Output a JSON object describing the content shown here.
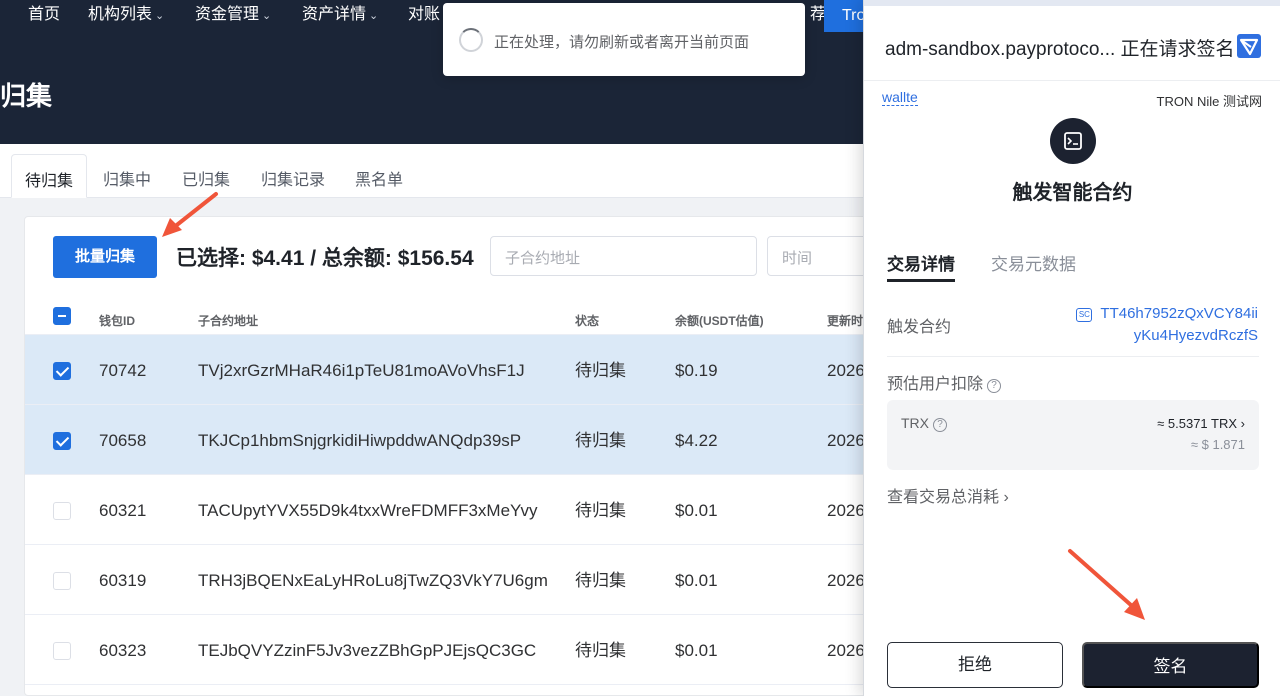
{
  "nav": {
    "items": [
      "首页",
      "机构列表",
      "资金管理",
      "资产详情",
      "对账"
    ],
    "right_button": "Tro",
    "right_fragment": "荐"
  },
  "page": {
    "title": "归集"
  },
  "tabs": [
    "待归集",
    "归集中",
    "已归集",
    "归集记录",
    "黑名单"
  ],
  "toolbar": {
    "batch_button": "批量归集",
    "summary": "已选择: $4.41 / 总余额: $156.54",
    "contract_placeholder": "子合约地址",
    "time_placeholder": "时间"
  },
  "table": {
    "headers": [
      "钱包ID",
      "子合约地址",
      "状态",
      "余额(USDT估值)",
      "更新时"
    ],
    "rows": [
      {
        "checked": true,
        "id": "70742",
        "address": "TVj2xrGzrMHaR46i1pTeU81moAVoVhsF1J",
        "status": "待归集",
        "balance": "$0.19",
        "updated": "2026"
      },
      {
        "checked": true,
        "id": "70658",
        "address": "TKJCp1hbmSnjgrkidiHiwpddwANQdp39sP",
        "status": "待归集",
        "balance": "$4.22",
        "updated": "2026"
      },
      {
        "checked": false,
        "id": "60321",
        "address": "TACUpytYVX55D9k4txxWreFDMFF3xMeYvy",
        "status": "待归集",
        "balance": "$0.01",
        "updated": "2026"
      },
      {
        "checked": false,
        "id": "60319",
        "address": "TRH3jBQENxEaLyHRoLu8jTwZQ3VkY7U6gm",
        "status": "待归集",
        "balance": "$0.01",
        "updated": "2026"
      },
      {
        "checked": false,
        "id": "60323",
        "address": "TEJbQVYZzinF5Jv3vezZBhGpPJEjsQC3GC",
        "status": "待归集",
        "balance": "$0.01",
        "updated": "2026"
      }
    ]
  },
  "toast": {
    "message": "正在处理，请勿刷新或者离开当前页面"
  },
  "wallet": {
    "header": "adm-sandbox.payprotoco... 正在请求签名",
    "account": "wallte",
    "network": "TRON Nile 测试网",
    "title": "触发智能合约",
    "tabs": [
      "交易详情",
      "交易元数据"
    ],
    "contract_label": "触发合约",
    "contract_address_line1": "TT46h7952zQxVCY84ii",
    "contract_address_line2": "yKu4HyezvdRczfS",
    "sc_badge": "SC",
    "fee_label": "预估用户扣除",
    "fee_token": "TRX",
    "fee_value": "≈ 5.5371 TRX",
    "fee_usd": "≈ $ 1.871",
    "total_fee_link": "查看交易总消耗",
    "reject_button": "拒绝",
    "sign_button": "签名"
  },
  "colors": {
    "nav_bg": "#1b2537",
    "primary": "#1f6fde",
    "selected_row": "#dbe9f7",
    "annotation_arrow": "#f0553a",
    "wallet_dark": "#1c2230"
  }
}
